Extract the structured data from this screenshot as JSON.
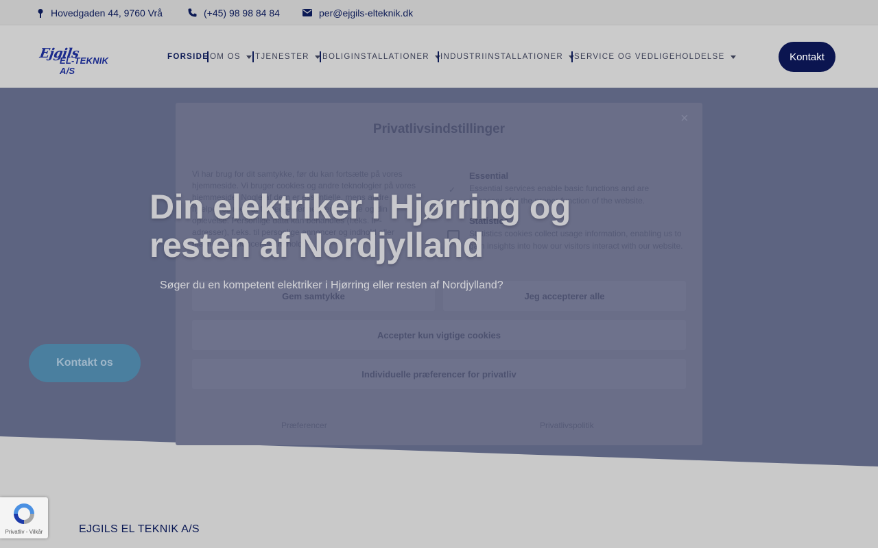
{
  "topbar": {
    "address": "Hovedgaden 44, 9760 Vrå",
    "phone": "(+45) 98 98 84 84",
    "email": "per@ejgils-elteknik.dk"
  },
  "logo": {
    "line1": "Ejgils",
    "line2": "EL-TEKNIK A/S"
  },
  "nav": {
    "items": [
      {
        "label": "FORSIDE"
      },
      {
        "label": "OM OS"
      },
      {
        "label": "TJENESTER"
      },
      {
        "label": "BOLIGINSTALLATIONER"
      },
      {
        "label": "INDUSTRIINSTALLATIONER"
      },
      {
        "label": "SERVICE OG VEDLIGEHOLDELSE"
      }
    ],
    "cta": "Kontakt"
  },
  "modal": {
    "title": "Privatlivsindstillinger",
    "close": "×",
    "text": "Vi har brug for dit samtykke, før du kan fortsætte på vores hjemmeside. Vi bruger cookies og andre teknologier på vores hjemmeside. Nogle af dem er essentielle, mens andre hjælper os med at forbedre denne hjemmeside og din oplevelse. Personlige data kan behandles (f.eks. IP-adresser), f.eks. til personlige annoncer og indhold eller måling af annoncer og indhold.",
    "categories": [
      {
        "name": "Essential",
        "desc": "Essential services enable basic functions and are necessary for the proper function of the website."
      },
      {
        "name": "Statistics",
        "desc": "Statistics cookies collect usage information, enabling us to gain insights into how our visitors interact with our website."
      }
    ],
    "buttons": {
      "save": "Gem samtykke",
      "accept_all": "Jeg accepterer alle",
      "accept_essential": "Accepter kun vigtige cookies",
      "individual": "Individuelle præferencer for privatliv"
    },
    "links": {
      "preferences": "Præferencer",
      "policy": "Privatlivspolitik"
    }
  },
  "hero": {
    "title": "Din elektriker i Hjørring og resten af Nordjylland",
    "subtitle": "Søger du en kompetent elektriker i Hjørring eller resten af Nordjylland?",
    "cta": "Kontakt os"
  },
  "company": "EJGILS EL TEKNIK A/S",
  "recaptcha": "Privatliv - Vilkår",
  "colors": {
    "navy": "#0b1550",
    "hero_overlay": "#5d6481",
    "cta_teal": "#4a7f9f"
  }
}
